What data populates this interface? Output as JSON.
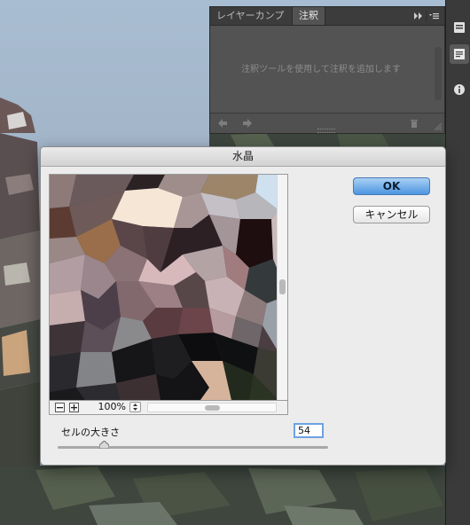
{
  "panel": {
    "tabs": [
      "レイヤーカンプ",
      "注釈"
    ],
    "active_tab": "注釈",
    "empty_message": "注釈ツールを使用して注釈を追加します"
  },
  "dialog": {
    "title": "水晶",
    "ok_label": "OK",
    "cancel_label": "キャンセル",
    "zoom": "100%",
    "cell_size_label": "セルの大きさ",
    "cell_size_value": "54",
    "cell_size_slider": {
      "value": 54,
      "min": 3,
      "max": 300
    }
  },
  "colors": {
    "accent": "#4d95e0",
    "panel_bg": "#535353",
    "dialog_bg": "#ececec"
  },
  "icons": [
    "layers-panel-icon",
    "notes-panel-icon",
    "info-icon",
    "expand-panel-icon",
    "panel-menu-icon",
    "previous-note-icon",
    "next-note-icon",
    "trash-icon",
    "resize-grip-icon",
    "zoom-out-icon",
    "zoom-in-icon"
  ]
}
